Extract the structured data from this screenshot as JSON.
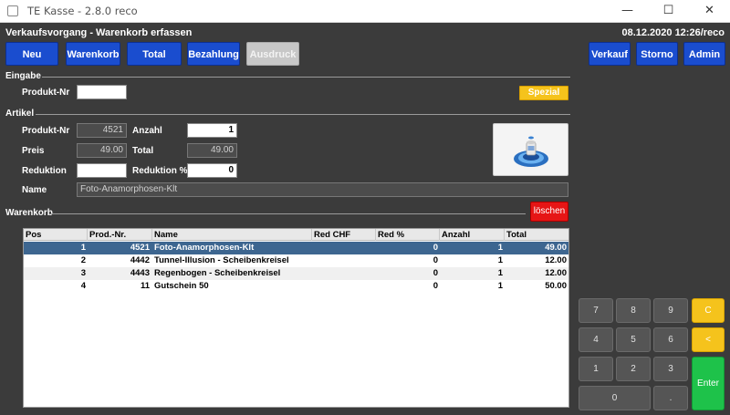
{
  "window": {
    "title": "TE Kasse - 2.8.0 reco",
    "controls": [
      "—",
      "☐",
      "✕"
    ]
  },
  "header": {
    "title": "Verkaufsvorgang - Warenkorb erfassen",
    "datetime": "08.12.2020 12:26/reco"
  },
  "toolbar": {
    "neu": "Neu",
    "warenkorb": "Warenkorb",
    "total": "Total",
    "bezahlung": "Bezahlung",
    "ausdruck": "Ausdruck",
    "verkauf": "Verkauf",
    "storno": "Storno",
    "admin": "Admin"
  },
  "eingabe": {
    "section": "Eingabe",
    "produkt_nr_label": "Produkt-Nr",
    "produkt_nr_value": "",
    "spezial": "Spezial"
  },
  "artikel": {
    "section": "Artikel",
    "produkt_nr_label": "Produkt-Nr",
    "produkt_nr_value": "4521",
    "anzahl_label": "Anzahl",
    "anzahl_value": "1",
    "preis_label": "Preis",
    "preis_value": "49.00",
    "total_label": "Total",
    "total_value": "49.00",
    "reduktion_label": "Reduktion",
    "reduktion_value": "",
    "reduktion_pct_label": "Reduktion %",
    "reduktion_pct_value": "0",
    "name_label": "Name",
    "name_value": "Foto-Anamorphosen-Klt"
  },
  "warenkorb": {
    "section": "Warenkorb",
    "loeschen": "löschen",
    "columns": [
      "Pos",
      "Prod.-Nr.",
      "Name",
      "Red CHF",
      "Red %",
      "Anzahl",
      "Total"
    ],
    "rows": [
      {
        "pos": "1",
        "prod_nr": "4521",
        "name": "Foto-Anamorphosen-Klt",
        "red_chf": "",
        "red_pct": "0",
        "anzahl": "1",
        "total": "49.00"
      },
      {
        "pos": "2",
        "prod_nr": "4442",
        "name": "Tunnel-Illusion - Scheibenkreisel",
        "red_chf": "",
        "red_pct": "0",
        "anzahl": "1",
        "total": "12.00"
      },
      {
        "pos": "3",
        "prod_nr": "4443",
        "name": "Regenbogen - Scheibenkreisel",
        "red_chf": "",
        "red_pct": "0",
        "anzahl": "1",
        "total": "12.00"
      },
      {
        "pos": "4",
        "prod_nr": "11",
        "name": "Gutschein 50",
        "red_chf": "",
        "red_pct": "0",
        "anzahl": "1",
        "total": "50.00"
      }
    ]
  },
  "keypad": {
    "k7": "7",
    "k8": "8",
    "k9": "9",
    "kc": "C",
    "k4": "4",
    "k5": "5",
    "k6": "6",
    "kback": "<",
    "k1": "1",
    "k2": "2",
    "k3": "3",
    "enter": "Enter",
    "k0": "0",
    "kdot": "."
  },
  "colors": {
    "background": "#3b3b3b",
    "button_blue": "#1a4dcf",
    "spezial_yellow": "#f5c31c",
    "delete_red": "#e61515",
    "enter_green": "#1ec24a",
    "selected_row": "#3d6690"
  }
}
